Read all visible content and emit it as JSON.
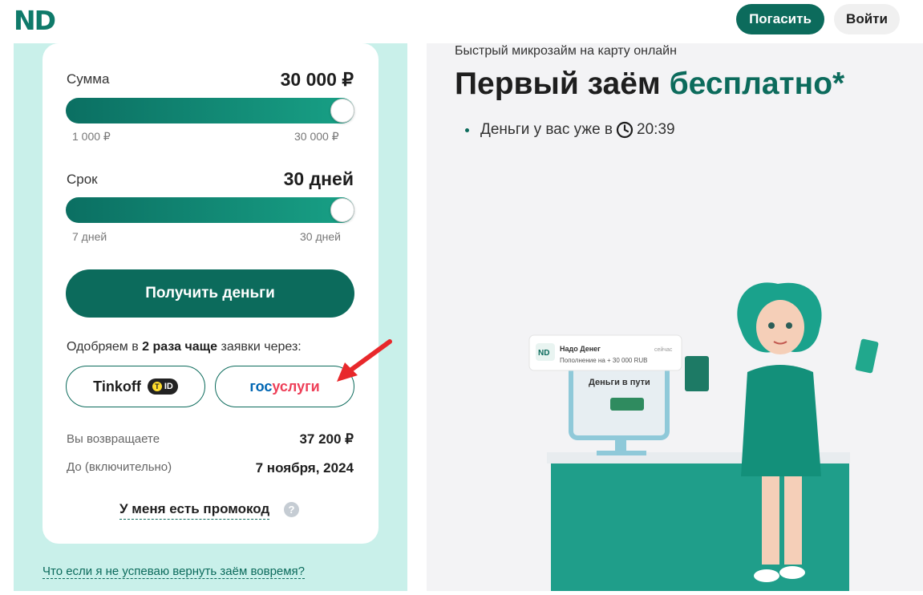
{
  "header": {
    "logo": "ND",
    "pay_label": "Погасить",
    "login_label": "Войти"
  },
  "calculator": {
    "amount": {
      "label": "Сумма",
      "value": "30 000 ₽",
      "min_label": "1 000 ₽",
      "max_label": "30 000 ₽",
      "fill": 1.0
    },
    "term": {
      "label": "Срок",
      "value": "30 дней",
      "min_label": "7 дней",
      "max_label": "30 дней",
      "fill": 1.0
    },
    "get_money_label": "Получить деньги",
    "approve_pre": "Одобряем в ",
    "approve_bold": "2 раза чаще",
    "approve_post": " заявки через:",
    "tinkoff_label": "Tinkoff",
    "tinkoff_badge": "ID",
    "gos_part1": "гос",
    "gos_part2": "услуги",
    "return_label": "Вы возвращаете",
    "return_value": "37 200 ₽",
    "until_label": "До (включительно)",
    "until_value": "7 ноября, 2024",
    "promo_label": "У меня есть промокод",
    "help_icon": "?",
    "faq_link": "Что если я не успеваю вернуть заём вовремя?"
  },
  "hero": {
    "subtitle": "Быстрый микрозайм на карту онлайн",
    "title_main": "Первый заём ",
    "title_accent": "бесплатно*",
    "bullet_pre": "Деньги у вас уже в",
    "bullet_time": "20:39"
  },
  "colors": {
    "brand": "#0c6b5c",
    "accent_bg": "#c9f0ea",
    "arrow": "#e8282b"
  }
}
